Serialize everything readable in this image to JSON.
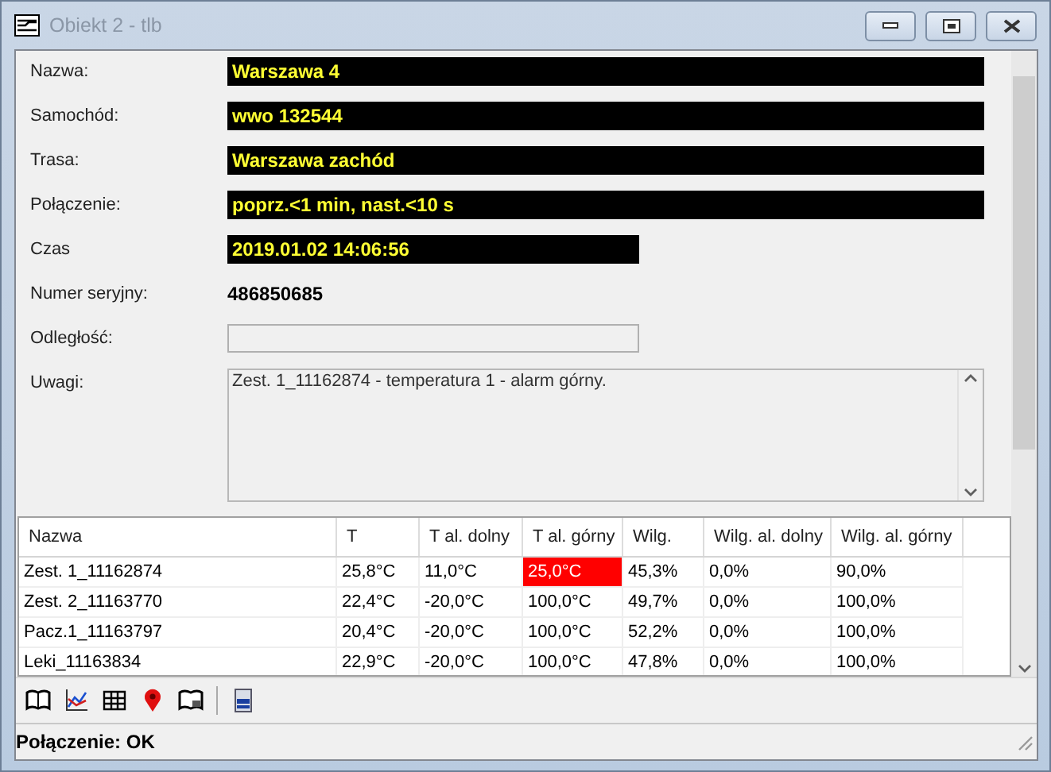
{
  "window": {
    "title": "Obiekt 2 - tlb"
  },
  "form": [
    {
      "label": "Nazwa:",
      "kind": "display",
      "value": "Warszawa 4"
    },
    {
      "label": "Samochód:",
      "kind": "display",
      "value": "wwo 132544"
    },
    {
      "label": "Trasa:",
      "kind": "display",
      "value": "Warszawa zachód"
    },
    {
      "label": "Połączenie:",
      "kind": "display",
      "value": "poprz.<1 min, nast.<10 s"
    },
    {
      "label": "Czas",
      "kind": "display_short",
      "value": "2019.01.02 14:06:56"
    },
    {
      "label": "Numer seryjny:",
      "kind": "text",
      "value": "486850685"
    },
    {
      "label": "Odległość:",
      "kind": "field_short"
    },
    {
      "label": "Uwagi:",
      "kind": "memo",
      "value": "Zest. 1_11162874 - temperatura 1 - alarm górny."
    }
  ],
  "table": {
    "columns": [
      "Nazwa",
      "T",
      "T al. dolny",
      "T al. górny",
      "Wilg.",
      "Wilg. al. dolny",
      "Wilg. al. górny"
    ],
    "rows": [
      [
        {
          "text": "Zest. 1_11162874",
          "alarm": false
        },
        {
          "text": "25,8°C",
          "alarm": false
        },
        {
          "text": "11,0°C",
          "alarm": false
        },
        {
          "text": "25,0°C",
          "alarm": true
        },
        {
          "text": "45,3%",
          "alarm": false
        },
        {
          "text": "0,0%",
          "alarm": false
        },
        {
          "text": "90,0%",
          "alarm": false
        }
      ],
      [
        {
          "text": "Zest. 2_11163770",
          "alarm": false
        },
        {
          "text": "22,4°C",
          "alarm": false
        },
        {
          "text": "-20,0°C",
          "alarm": false
        },
        {
          "text": "100,0°C",
          "alarm": false
        },
        {
          "text": "49,7%",
          "alarm": false
        },
        {
          "text": "0,0%",
          "alarm": false
        },
        {
          "text": "100,0%",
          "alarm": false
        }
      ],
      [
        {
          "text": "Pacz.1_11163797",
          "alarm": false
        },
        {
          "text": "20,4°C",
          "alarm": false
        },
        {
          "text": "-20,0°C",
          "alarm": false
        },
        {
          "text": "100,0°C",
          "alarm": false
        },
        {
          "text": "52,2%",
          "alarm": false
        },
        {
          "text": "0,0%",
          "alarm": false
        },
        {
          "text": "100,0%",
          "alarm": false
        }
      ],
      [
        {
          "text": "Leki_11163834",
          "alarm": false
        },
        {
          "text": "22,9°C",
          "alarm": false
        },
        {
          "text": "-20,0°C",
          "alarm": false
        },
        {
          "text": "100,0°C",
          "alarm": false
        },
        {
          "text": "47,8%",
          "alarm": false
        },
        {
          "text": "0,0%",
          "alarm": false
        },
        {
          "text": "100,0%",
          "alarm": false
        }
      ]
    ]
  },
  "status_bar": {
    "text": "Połączenie: OK"
  }
}
